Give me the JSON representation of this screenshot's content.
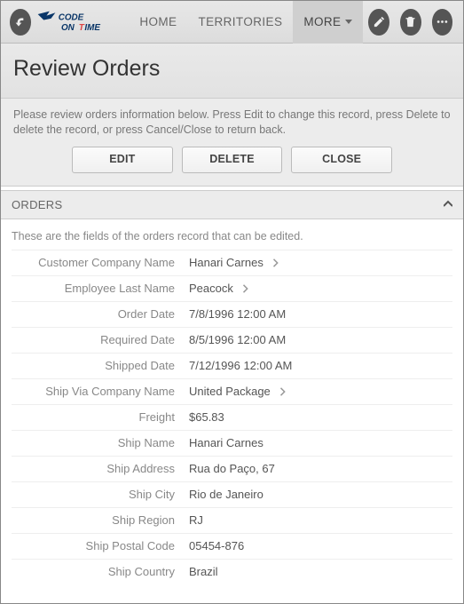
{
  "nav": {
    "home": "HOME",
    "territories": "TERRITORIES",
    "more": "MORE"
  },
  "page": {
    "title": "Review Orders",
    "instruction": "Please review orders information below. Press Edit to change this record, press Delete to delete the record, or press Cancel/Close to return back."
  },
  "buttons": {
    "edit": "EDIT",
    "delete": "DELETE",
    "close": "CLOSE"
  },
  "section": {
    "title": "ORDERS",
    "hint": "These are the fields of the orders record that can be edited."
  },
  "fields": [
    {
      "label": "Customer Company Name",
      "value": "Hanari Carnes",
      "link": true
    },
    {
      "label": "Employee Last Name",
      "value": "Peacock",
      "link": true
    },
    {
      "label": "Order Date",
      "value": "7/8/1996 12:00 AM",
      "link": false
    },
    {
      "label": "Required Date",
      "value": "8/5/1996 12:00 AM",
      "link": false
    },
    {
      "label": "Shipped Date",
      "value": "7/12/1996 12:00 AM",
      "link": false
    },
    {
      "label": "Ship Via Company Name",
      "value": "United Package",
      "link": true
    },
    {
      "label": "Freight",
      "value": "$65.83",
      "link": false
    },
    {
      "label": "Ship Name",
      "value": "Hanari Carnes",
      "link": false
    },
    {
      "label": "Ship Address",
      "value": "Rua do Paço, 67",
      "link": false
    },
    {
      "label": "Ship City",
      "value": "Rio de Janeiro",
      "link": false
    },
    {
      "label": "Ship Region",
      "value": "RJ",
      "link": false
    },
    {
      "label": "Ship Postal Code",
      "value": "05454-876",
      "link": false
    },
    {
      "label": "Ship Country",
      "value": "Brazil",
      "link": false
    }
  ]
}
